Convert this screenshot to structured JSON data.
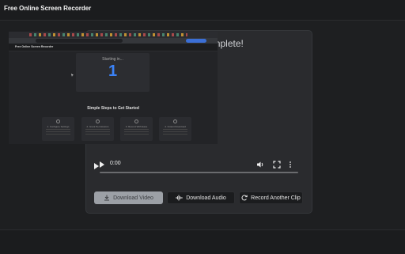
{
  "app": {
    "title": "Free Online Screen Recorder"
  },
  "card": {
    "title": "Recording Complete!"
  },
  "preview": {
    "inner_title": "Free Online Screen Recorder",
    "starting_text": "Starting in...",
    "countdown": "1",
    "steps_title": "Simple Steps to Get Started",
    "steps": [
      {
        "label": "1. Configure Settings"
      },
      {
        "label": "2. Grant Permissions"
      },
      {
        "label": "3. Record With Ease"
      },
      {
        "label": "4. Instant Download"
      }
    ]
  },
  "player": {
    "time": "0:00",
    "progress": 0,
    "icons": {
      "play": "play-icon",
      "volume": "volume-icon",
      "fullscreen": "fullscreen-icon",
      "menu": "more-options-icon"
    }
  },
  "actions": {
    "download_video": "Download Video",
    "download_audio": "Download Audio",
    "record_another": "Record Another Clip",
    "icons": {
      "download": "download-icon",
      "audio": "audio-wave-icon",
      "refresh": "refresh-icon"
    }
  },
  "colors": {
    "accent": "#3b82f6",
    "primary_button": "#9ca0a6",
    "background": "#1e1f21",
    "card": "#2a2b2e"
  }
}
